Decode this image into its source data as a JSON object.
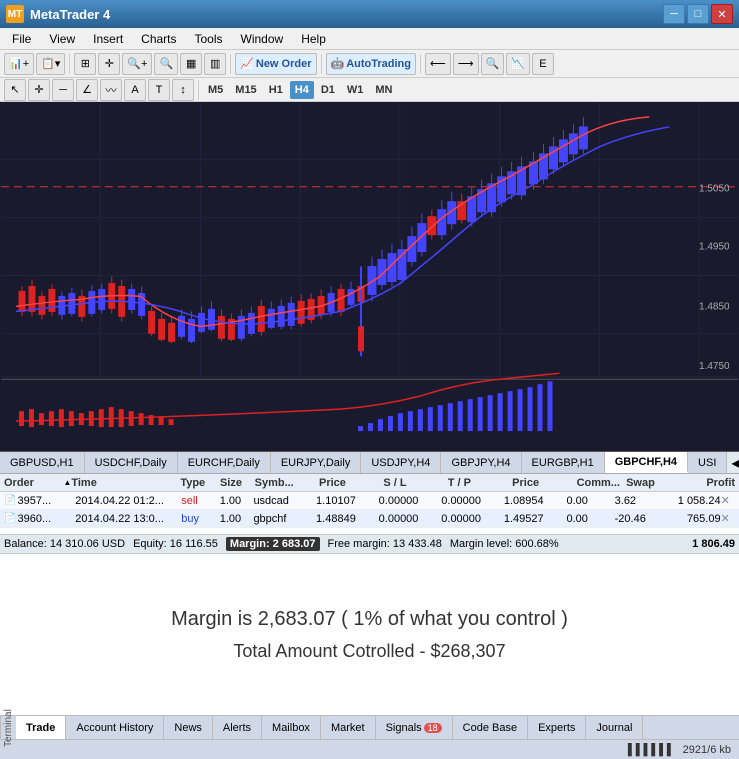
{
  "titleBar": {
    "title": "MetaTrader 4",
    "logo": "MT",
    "controls": [
      "minimize",
      "maximize",
      "close"
    ]
  },
  "menuBar": {
    "items": [
      "File",
      "View",
      "Insert",
      "Charts",
      "Tools",
      "Window",
      "Help"
    ]
  },
  "toolbar1": {
    "newOrderLabel": "New Order",
    "autoTradingLabel": "AutoTrading"
  },
  "toolbar2": {
    "timeframes": [
      "M5",
      "M15",
      "H1",
      "H4",
      "D1",
      "W1",
      "MN"
    ],
    "active": "H4"
  },
  "chartTabs": {
    "tabs": [
      "GBPUSD,H1",
      "USDCHF,Daily",
      "EURCHF,Daily",
      "EURJPY,Daily",
      "USDJPY,H4",
      "GBPJPY,H4",
      "EURGBP,H1",
      "GBPCHF,H4",
      "USI"
    ],
    "active": "GBPCHF,H4"
  },
  "ordersTable": {
    "headers": {
      "order": "Order",
      "time": "Time",
      "type": "Type",
      "size": "Size",
      "symbol": "Symb...",
      "price": "Price",
      "sl": "S / L",
      "tp": "T / P",
      "price2": "Price",
      "comm": "Comm...",
      "swap": "Swap",
      "profit": "Profit"
    },
    "rows": [
      {
        "order": "3957...",
        "time": "2014.04.22 01:2...",
        "type": "sell",
        "size": "1.00",
        "symbol": "usdcad",
        "price": "1.10107",
        "sl": "0.00000",
        "tp": "0.00000",
        "price2": "1.08954",
        "comm": "0.00",
        "swap": "3.62",
        "profit": "1 058.24"
      },
      {
        "order": "3960...",
        "time": "2014.04.22 13:0...",
        "type": "buy",
        "size": "1.00",
        "symbol": "gbpchf",
        "price": "1.48849",
        "sl": "0.00000",
        "tp": "0.00000",
        "price2": "1.49527",
        "comm": "0.00",
        "swap": "-20.46",
        "profit": "765.09"
      }
    ]
  },
  "balanceBar": {
    "balance": "Balance: 14 310.06 USD",
    "equity": "Equity: 16 116.55",
    "margin": "Margin: 2 683.07",
    "freeMargin": "Free margin: 13 433.48",
    "marginLevel": "Margin level: 600.68%",
    "totalProfit": "1 806.49"
  },
  "infoArea": {
    "line1": "Margin is 2,683.07   ( 1% of what you control )",
    "line2": "Total Amount Cotrolled - $268,307"
  },
  "terminalTabs": {
    "label": "Terminal",
    "tabs": [
      "Trade",
      "Account History",
      "News",
      "Alerts",
      "Mailbox",
      "Market",
      "Signals",
      "Code Base",
      "Experts",
      "Journal"
    ],
    "active": "Trade",
    "signalsBadge": "18"
  },
  "statusBar": {
    "barIndicator": "▌▌▌▌▌▌",
    "diskInfo": "2921/6 kb"
  }
}
